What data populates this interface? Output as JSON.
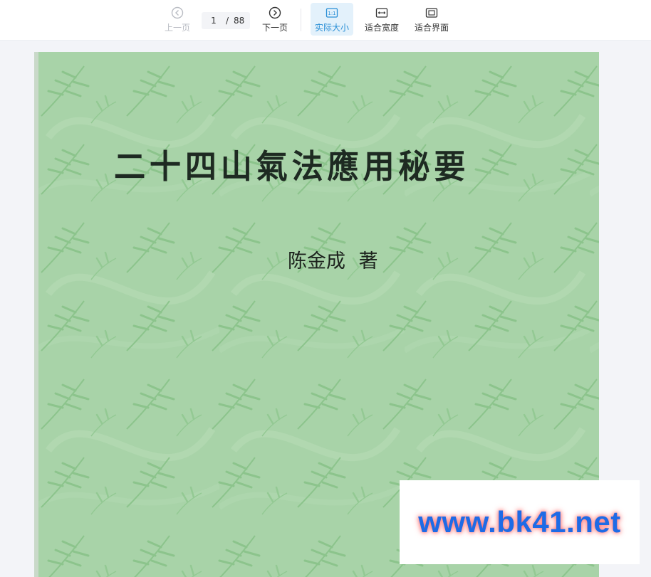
{
  "toolbar": {
    "prev_label": "上一页",
    "next_label": "下一页",
    "current_page": "1",
    "page_separator": "/",
    "total_pages": "88",
    "actual_size_label": "实际大小",
    "fit_width_label": "适合宽度",
    "fit_screen_label": "适合界面",
    "active_mode": "actual-size",
    "icons": {
      "prev": "chevron-left-circle-icon",
      "next": "chevron-right-circle-icon",
      "actual": "one-to-one-icon",
      "fit_width": "arrows-horizontal-icon",
      "fit_screen": "fit-screen-icon"
    },
    "accent_color": "#2a8fd6"
  },
  "document": {
    "title": "二十四山氣法應用秘要",
    "author": "陈金成  著",
    "cover_color": "#a8d3a8"
  },
  "watermark": {
    "text": "www.bk41.net",
    "color": "#1e6be6"
  }
}
